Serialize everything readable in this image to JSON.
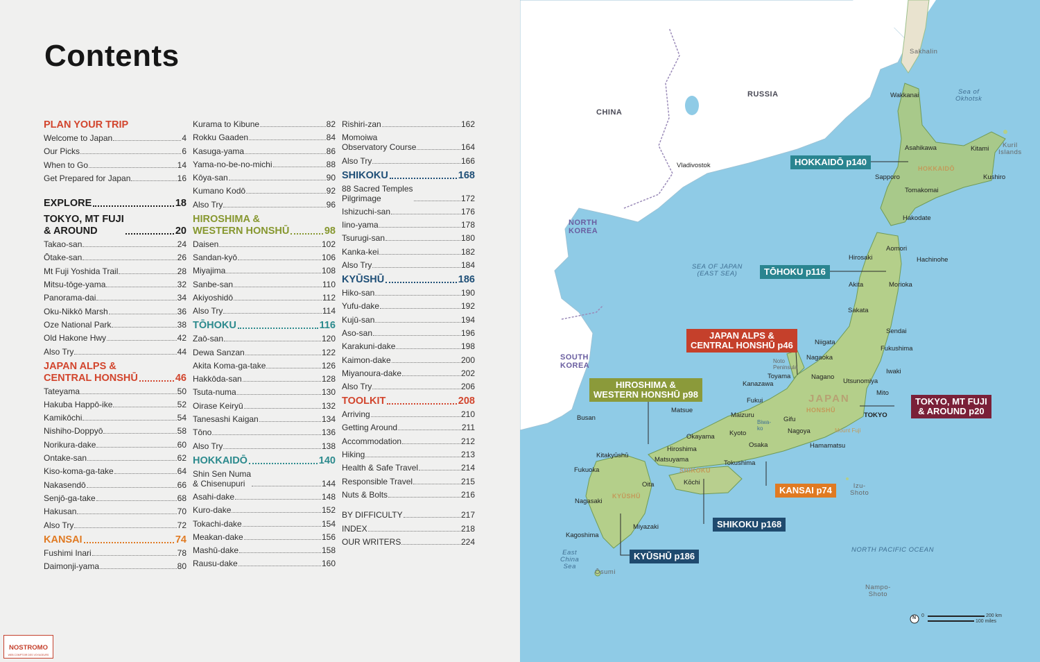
{
  "title": "Contents",
  "columns": [
    [
      {
        "kind": "head",
        "text": "PLAN YOUR TRIP",
        "page": "",
        "color": "red"
      },
      {
        "kind": "item",
        "text": "Welcome to Japan",
        "page": "4"
      },
      {
        "kind": "item",
        "text": "Our Picks",
        "page": "6"
      },
      {
        "kind": "item",
        "text": "When to Go",
        "page": "14"
      },
      {
        "kind": "item",
        "text": "Get Prepared for Japan",
        "page": "16"
      },
      {
        "kind": "gap"
      },
      {
        "kind": "head",
        "text": "EXPLORE",
        "page": "18",
        "color": "black"
      },
      {
        "kind": "head",
        "text": "TOKYO, MT FUJI\n& AROUND",
        "page": "20",
        "color": "black"
      },
      {
        "kind": "item",
        "text": "Takao-san",
        "page": "24"
      },
      {
        "kind": "item",
        "text": "Ōtake-san",
        "page": "26"
      },
      {
        "kind": "item",
        "text": "Mt Fuji Yoshida Trail",
        "page": "28"
      },
      {
        "kind": "item",
        "text": "Mitsu-tōge-yama",
        "page": "32"
      },
      {
        "kind": "item",
        "text": "Panorama-dai",
        "page": "34"
      },
      {
        "kind": "item",
        "text": "Oku-Nikkō Marsh",
        "page": "36"
      },
      {
        "kind": "item",
        "text": "Oze National Park",
        "page": "38"
      },
      {
        "kind": "item",
        "text": "Old Hakone Hwy",
        "page": "42"
      },
      {
        "kind": "item",
        "text": "Also Try",
        "page": "44"
      },
      {
        "kind": "head",
        "text": "JAPAN ALPS &\nCENTRAL HONSHŪ",
        "page": "46",
        "color": "red"
      },
      {
        "kind": "item",
        "text": "Tateyama",
        "page": "50"
      },
      {
        "kind": "item",
        "text": "Hakuba Happō-ike",
        "page": "52"
      },
      {
        "kind": "item",
        "text": "Kamikōchi",
        "page": "54"
      },
      {
        "kind": "item",
        "text": "Nishiho-Doppyō",
        "page": "58"
      },
      {
        "kind": "item",
        "text": "Norikura-dake",
        "page": "60"
      },
      {
        "kind": "item",
        "text": "Ontake-san",
        "page": "62"
      },
      {
        "kind": "item",
        "text": "Kiso-koma-ga-take",
        "page": "64"
      },
      {
        "kind": "item",
        "text": "Nakasendō",
        "page": "66"
      },
      {
        "kind": "item",
        "text": "Senjō-ga-take",
        "page": "68"
      },
      {
        "kind": "item",
        "text": "Hakusan",
        "page": "70"
      },
      {
        "kind": "item",
        "text": "Also Try",
        "page": "72"
      },
      {
        "kind": "head",
        "text": "KANSAI",
        "page": "74",
        "color": "orange"
      },
      {
        "kind": "item",
        "text": "Fushimi Inari",
        "page": "78"
      },
      {
        "kind": "item",
        "text": "Daimonji-yama",
        "page": "80"
      }
    ],
    [
      {
        "kind": "item",
        "text": "Kurama to Kibune",
        "page": "82"
      },
      {
        "kind": "item",
        "text": "Rokku Gaaden",
        "page": "84"
      },
      {
        "kind": "item",
        "text": "Kasuga-yama",
        "page": "86"
      },
      {
        "kind": "item",
        "text": "Yama-no-be-no-michi",
        "page": "88"
      },
      {
        "kind": "item",
        "text": "Kōya-san",
        "page": "90"
      },
      {
        "kind": "item",
        "text": "Kumano Kodō",
        "page": "92"
      },
      {
        "kind": "item",
        "text": "Also Try",
        "page": "96"
      },
      {
        "kind": "head",
        "text": "HIROSHIMA &\nWESTERN HONSHŪ",
        "page": "98",
        "color": "olive"
      },
      {
        "kind": "item",
        "text": "Daisen",
        "page": "102"
      },
      {
        "kind": "item",
        "text": "Sandan-kyō",
        "page": "106"
      },
      {
        "kind": "item",
        "text": "Miyajima",
        "page": "108"
      },
      {
        "kind": "item",
        "text": "Sanbe-san",
        "page": "110"
      },
      {
        "kind": "item",
        "text": "Akiyoshidō",
        "page": "112"
      },
      {
        "kind": "item",
        "text": "Also Try",
        "page": "114"
      },
      {
        "kind": "head",
        "text": "TŌHOKU",
        "page": "116",
        "color": "teal"
      },
      {
        "kind": "item",
        "text": "Zaō-san",
        "page": "120"
      },
      {
        "kind": "item",
        "text": "Dewa Sanzan",
        "page": "122"
      },
      {
        "kind": "item",
        "text": "Akita Koma-ga-take",
        "page": "126"
      },
      {
        "kind": "item",
        "text": "Hakkōda-san",
        "page": "128"
      },
      {
        "kind": "item",
        "text": "Tsuta-numa",
        "page": "130"
      },
      {
        "kind": "item",
        "text": "Oirase Keiryū",
        "page": "132"
      },
      {
        "kind": "item",
        "text": "Tanesashi Kaigan",
        "page": "134"
      },
      {
        "kind": "item",
        "text": "Tōno",
        "page": "136"
      },
      {
        "kind": "item",
        "text": "Also Try",
        "page": "138"
      },
      {
        "kind": "head",
        "text": "HOKKAIDŌ",
        "page": "140",
        "color": "teal"
      },
      {
        "kind": "item",
        "text": "Shin Sen Numa\n& Chisenupuri",
        "page": "144"
      },
      {
        "kind": "item",
        "text": "Asahi-dake",
        "page": "148"
      },
      {
        "kind": "item",
        "text": "Kuro-dake",
        "page": "152"
      },
      {
        "kind": "item",
        "text": "Tokachi-dake",
        "page": "154"
      },
      {
        "kind": "item",
        "text": "Meakan-dake",
        "page": "156"
      },
      {
        "kind": "item",
        "text": "Mashū-dake",
        "page": "158"
      },
      {
        "kind": "item",
        "text": "Rausu-dake",
        "page": "160"
      }
    ],
    [
      {
        "kind": "item",
        "text": "Rishiri-zan",
        "page": "162"
      },
      {
        "kind": "item",
        "text": "Momoiwa\nObservatory Course",
        "page": "164"
      },
      {
        "kind": "item",
        "text": "Also Try",
        "page": "166"
      },
      {
        "kind": "head",
        "text": "SHIKOKU",
        "page": "168",
        "color": "navy"
      },
      {
        "kind": "item",
        "text": "88 Sacred Temples\nPilgrimage",
        "page": "172"
      },
      {
        "kind": "item",
        "text": "Ishizuchi-san",
        "page": "176"
      },
      {
        "kind": "item",
        "text": "Iino-yama",
        "page": "178"
      },
      {
        "kind": "item",
        "text": "Tsurugi-san",
        "page": "180"
      },
      {
        "kind": "item",
        "text": "Kanka-kei",
        "page": "182"
      },
      {
        "kind": "item",
        "text": "Also Try",
        "page": "184"
      },
      {
        "kind": "head",
        "text": "KYŪSHŪ",
        "page": "186",
        "color": "navy"
      },
      {
        "kind": "item",
        "text": "Hiko-san",
        "page": "190"
      },
      {
        "kind": "item",
        "text": "Yufu-dake",
        "page": "192"
      },
      {
        "kind": "item",
        "text": "Kujū-san",
        "page": "194"
      },
      {
        "kind": "item",
        "text": "Aso-san",
        "page": "196"
      },
      {
        "kind": "item",
        "text": "Karakuni-dake",
        "page": "198"
      },
      {
        "kind": "item",
        "text": "Kaimon-dake",
        "page": "200"
      },
      {
        "kind": "item",
        "text": "Miyanoura-dake",
        "page": "202"
      },
      {
        "kind": "item",
        "text": "Also Try",
        "page": "206"
      },
      {
        "kind": "head",
        "text": "TOOLKIT",
        "page": "208",
        "color": "red"
      },
      {
        "kind": "item",
        "text": "Arriving",
        "page": "210"
      },
      {
        "kind": "item",
        "text": "Getting Around",
        "page": "211"
      },
      {
        "kind": "item",
        "text": "Accommodation",
        "page": "212"
      },
      {
        "kind": "item",
        "text": "Hiking",
        "page": "213"
      },
      {
        "kind": "item",
        "text": "Health & Safe Travel",
        "page": "214"
      },
      {
        "kind": "item",
        "text": "Responsible Travel",
        "page": "215"
      },
      {
        "kind": "item",
        "text": "Nuts & Bolts",
        "page": "216"
      },
      {
        "kind": "gap"
      },
      {
        "kind": "item",
        "text": "BY DIFFICULTY",
        "page": "217"
      },
      {
        "kind": "item",
        "text": "INDEX",
        "page": "218"
      },
      {
        "kind": "item",
        "text": "OUR WRITERS",
        "page": "224"
      }
    ]
  ],
  "map": {
    "countries": {
      "china": "CHINA",
      "russia": "RUSSIA",
      "north_korea": "NORTH\nKOREA",
      "south_korea": "SOUTH\nKOREA",
      "japan": "JAPAN"
    },
    "seas": {
      "sea_of_japan": "SEA OF JAPAN\n(EAST SEA)",
      "sea_of_okhotsk": "Sea of\nOkhotsk",
      "pacific": "NORTH PACIFIC OCEAN",
      "east_china": "East\nChina\nSea"
    },
    "islands": {
      "sakhalin": "Sakhalin",
      "kuril": "Kuril\nIslands",
      "izu": "Izu-\nShoto",
      "nampo": "Nampo-\nShoto",
      "osumi": "Ōsumi"
    },
    "regions": {
      "hokkaido": "HOKKAIDŌ",
      "honshu": "HONSHŪ",
      "shikoku": "SHIKOKU",
      "kyushu": "KYŪSHŪ"
    },
    "cities": {
      "vladivostok": "Vladivostok",
      "busan": "Busan",
      "wakkanai": "Wakkanai",
      "asahikawa": "Asahikawa",
      "kitami": "Kitami",
      "sapporo": "Sapporo",
      "kushiro": "Kushiro",
      "tomakomai": "Tomakomai",
      "hakodate": "Hakodate",
      "aomori": "Aomori",
      "hirosaki": "Hirosaki",
      "hachinohe": "Hachinohe",
      "akita": "Akita",
      "morioka": "Morioka",
      "sakata": "Sakata",
      "sendai": "Sendai",
      "niigata": "Niigata",
      "fukushima": "Fukushima",
      "nagaoka": "Nagaoka",
      "iwaki": "Iwaki",
      "noto": "Noto\nPeninsula",
      "toyama": "Toyama",
      "kanazawa": "Kanazawa",
      "nagano": "Nagano",
      "utsunomiya": "Utsunomiya",
      "fukui": "Fukui",
      "mito": "Mito",
      "tokyo": "TOKYO",
      "gifu": "Gifu",
      "matsue": "Matsue",
      "maizuru": "Maizuru",
      "biwa": "Biwa-\nko",
      "nagoya": "Nagoya",
      "mount_fuji": "Mount Fuji",
      "kyoto": "Kyoto",
      "okayama": "Okayama",
      "osaka": "Osaka",
      "hamamatsu": "Hamamatsu",
      "kitakyushu": "Kitakyūshū",
      "hiroshima": "Hiroshima",
      "matsuyama": "Matsuyama",
      "tokushima": "Tokushima",
      "kochi": "Kōchi",
      "fukuoka": "Fukuoka",
      "oita": "Oita",
      "nagasaki": "Nagasaki",
      "miyazaki": "Miyazaki",
      "kagoshima": "Kagoshima"
    },
    "callouts": {
      "hokkaido": "HOKKAIDŌ p140",
      "tohoku": "TŌHOKU p116",
      "japan_alps": "JAPAN ALPS &\nCENTRAL HONSHŪ p46",
      "hiroshima": "HIROSHIMA &\nWESTERN HONSHŪ p98",
      "tokyo": "TOKYO, MT FUJI\n& AROUND p20",
      "kansai": "KANSAI p74",
      "shikoku": "SHIKOKU p168",
      "kyushu": "KYŪSHŪ p186"
    },
    "scale": {
      "km": "200 km",
      "miles": "100 miles",
      "zero": "0",
      "north": "N"
    }
  },
  "logo": {
    "name": "NOSTROMO",
    "tagline": "WEB COMPTOIR DES VOYAGEURS"
  },
  "colors": {
    "red": "#d2452d",
    "black": "#1b1b1b",
    "teal": "#2c8a8d",
    "olive": "#86972f",
    "navy": "#1f4f77",
    "orange": "#e07a22",
    "sea": "#8fcbe6",
    "land": "#ffffff"
  }
}
